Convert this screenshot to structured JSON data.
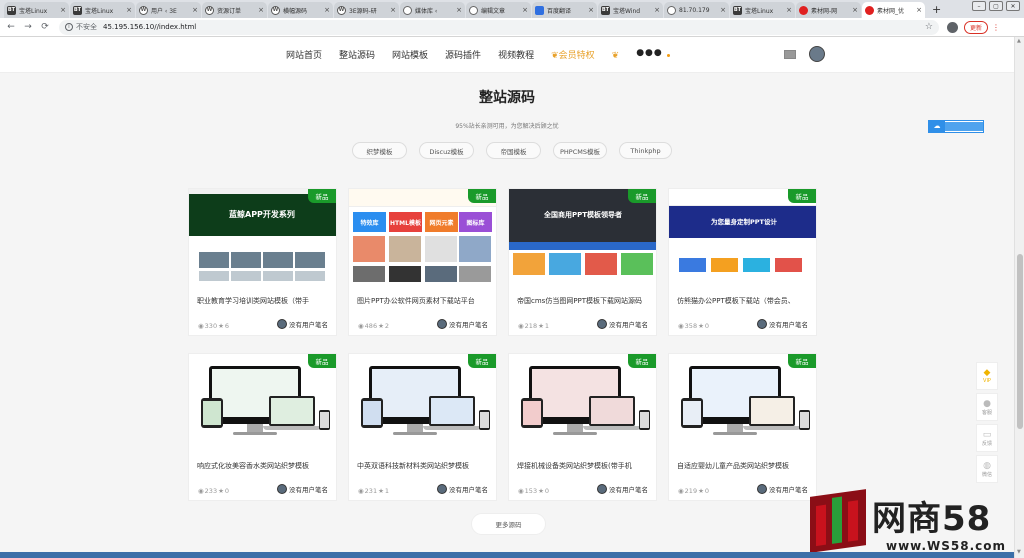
{
  "browser": {
    "tabs": [
      {
        "icon": "bt",
        "title": "宝塔Linux"
      },
      {
        "icon": "bt",
        "title": "宝塔Linux"
      },
      {
        "icon": "wp",
        "title": "用户 ‹ 3E"
      },
      {
        "icon": "wp",
        "title": "资源订单"
      },
      {
        "icon": "wp",
        "title": "横幅源码"
      },
      {
        "icon": "wp",
        "title": "3E源码-研"
      },
      {
        "icon": "globe",
        "title": "媒体库 ‹"
      },
      {
        "icon": "globe",
        "title": "编辑文章"
      },
      {
        "icon": "bd",
        "title": "百度翻译"
      },
      {
        "icon": "bt",
        "title": "宝塔Wind"
      },
      {
        "icon": "globe",
        "title": "81.70.179"
      },
      {
        "icon": "bt",
        "title": "宝塔Linux"
      },
      {
        "icon": "red",
        "title": "素材网-网"
      },
      {
        "icon": "red",
        "title": "素材网_优"
      }
    ],
    "security_label": "不安全",
    "url": "45.195.156.10//index.html",
    "update_label": "更新",
    "new_tab": "+",
    "close_glyph": "×"
  },
  "header": {
    "menu": [
      "网站首页",
      "整站源码",
      "网站模板",
      "源码插件",
      "视频教程"
    ],
    "vip_label": "会员特权",
    "more_label": "●●●"
  },
  "section": {
    "title": "整站源码",
    "subtitle": "95%站长亲测可用，为您解决后顾之忧",
    "filters": [
      "织梦模板",
      "Discuz模板",
      "帝国模板",
      "PHPCMS模板",
      "Thinkphp"
    ]
  },
  "cards": [
    {
      "title": "职业教育学习培训类网站模板（带手",
      "views": "330",
      "likes": "6",
      "author": "没有用户笔名",
      "badge": "新品",
      "thumb_text": "蓝鲸APP开发系列"
    },
    {
      "title": "图片PPT办公软件网页素材下载站平台",
      "views": "486",
      "likes": "2",
      "author": "没有用户笔名",
      "badge": "新品",
      "thumb_tiles": [
        "特效库",
        "HTML模板",
        "网页元素",
        "图标库"
      ]
    },
    {
      "title": "帝国cms仿当图网PPT模板下载网站源码",
      "views": "218",
      "likes": "1",
      "author": "没有用户笔名",
      "badge": "新品",
      "thumb_text": "全国商用PPT模板领导者"
    },
    {
      "title": "仿熊猫办公PPT模板下载站（带会员、",
      "views": "358",
      "likes": "0",
      "author": "没有用户笔名",
      "badge": "新品",
      "thumb_text": "为您量身定制PPT设计"
    },
    {
      "title": "响应式化妆美容香水类网站织梦模板",
      "views": "233",
      "likes": "0",
      "author": "没有用户笔名",
      "badge": "新品"
    },
    {
      "title": "中英双语科技新材料类网站织梦模板",
      "views": "231",
      "likes": "1",
      "author": "没有用户笔名",
      "badge": "新品"
    },
    {
      "title": "焊接机械设备类网站织梦模板(带手机",
      "views": "153",
      "likes": "0",
      "author": "没有用户笔名",
      "badge": "新品"
    },
    {
      "title": "自适应婴幼儿童产品类网站织梦模板",
      "views": "219",
      "likes": "0",
      "author": "没有用户笔名",
      "badge": "新品"
    }
  ],
  "more_button": "更多源码",
  "tools": [
    {
      "icon": "diamond-icon",
      "label": "VIP"
    },
    {
      "icon": "user-icon",
      "label": "客服"
    },
    {
      "icon": "chat-icon",
      "label": "反馈"
    },
    {
      "icon": "wechat-icon",
      "label": "微信"
    }
  ],
  "watermark": {
    "brand": "网商58",
    "url": "www.WS58.com"
  },
  "colors": {
    "badge": "#1a9a2a",
    "vip": "#e8a12a",
    "update": "#d93025",
    "brand_red": "#c8121d"
  }
}
